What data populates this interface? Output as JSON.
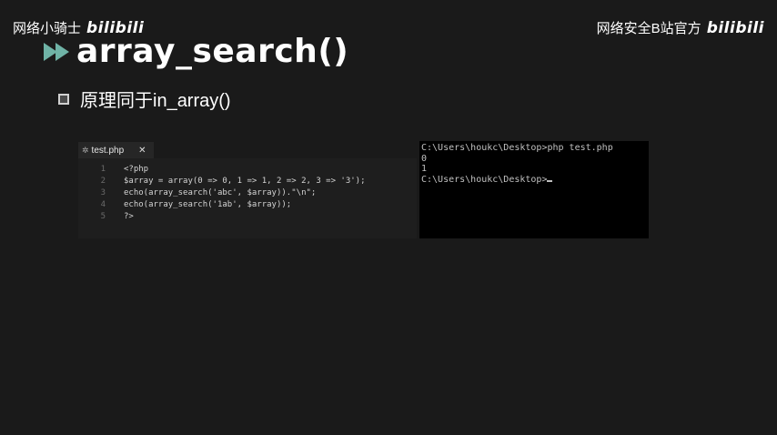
{
  "watermarks": {
    "left_text": "网络小骑士",
    "right_text": "网络安全B站官方",
    "logo_text": "bilibili"
  },
  "slide": {
    "title": "array_search()",
    "bullet": "原理同于in_array()"
  },
  "editor": {
    "tab_label": "test.php",
    "tab_close": "✕",
    "lines": [
      {
        "num": "1",
        "code": "<?php"
      },
      {
        "num": "2",
        "code": "$array = array(0 => 0, 1 => 1, 2 => 2, 3 => '3');"
      },
      {
        "num": "3",
        "code": "echo(array_search('abc', $array)).\"\\n\";"
      },
      {
        "num": "4",
        "code": "echo(array_search('1ab', $array));"
      },
      {
        "num": "5",
        "code": "?>"
      }
    ]
  },
  "terminal": {
    "lines": [
      "C:\\Users\\houkc\\Desktop>php test.php",
      "0",
      "1",
      "C:\\Users\\houkc\\Desktop>"
    ]
  },
  "colors": {
    "background": "#1a1a1a",
    "accent": "#6fb3a6",
    "terminal_bg": "#000000"
  }
}
